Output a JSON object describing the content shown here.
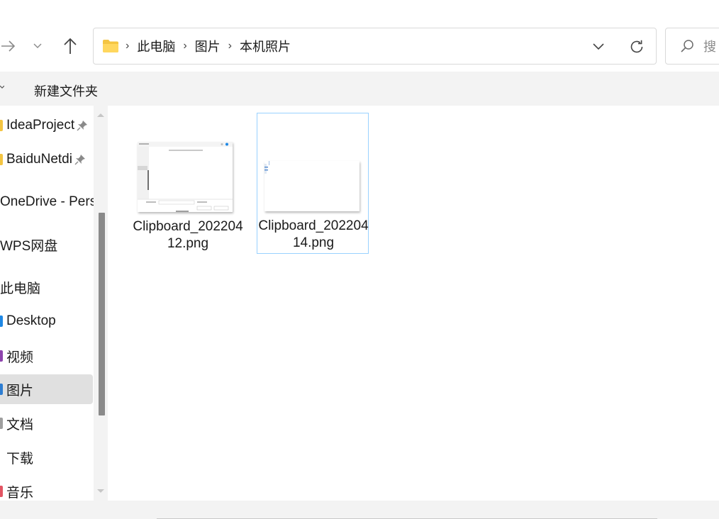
{
  "address_bar": {
    "crumbs": [
      "此电脑",
      "图片",
      "本机照片"
    ]
  },
  "search": {
    "placeholder": "搜"
  },
  "command_bar": {
    "new_folder_label": "新建文件夹"
  },
  "sidebar": {
    "items": [
      {
        "label": "IdeaProject",
        "icon": "folder-icon",
        "pinned": true
      },
      {
        "label": "BaiduNetdi",
        "icon": "folder-icon",
        "pinned": true
      },
      {
        "label": "OneDrive - Pers",
        "icon": "onedrive-icon"
      },
      {
        "label": "WPS网盘",
        "icon": "wps-cloud-icon"
      },
      {
        "label": "此电脑",
        "icon": "pc-icon"
      },
      {
        "label": "Desktop",
        "icon": "desktop-icon"
      },
      {
        "label": "视频",
        "icon": "video-icon"
      },
      {
        "label": "图片",
        "icon": "pictures-icon",
        "selected": true
      },
      {
        "label": "文档",
        "icon": "documents-icon"
      },
      {
        "label": "下载",
        "icon": "downloads-icon"
      },
      {
        "label": "音乐",
        "icon": "music-icon"
      }
    ]
  },
  "files": [
    {
      "name": "Clipboard_20220412.png"
    },
    {
      "name": "Clipboard_20220414.png",
      "focused": true
    }
  ],
  "colors": {
    "accent": "#0078d4",
    "selection_border": "#99d1ff",
    "folder": "#f4c542",
    "scrollbar_thumb": "#8a8a8a"
  }
}
